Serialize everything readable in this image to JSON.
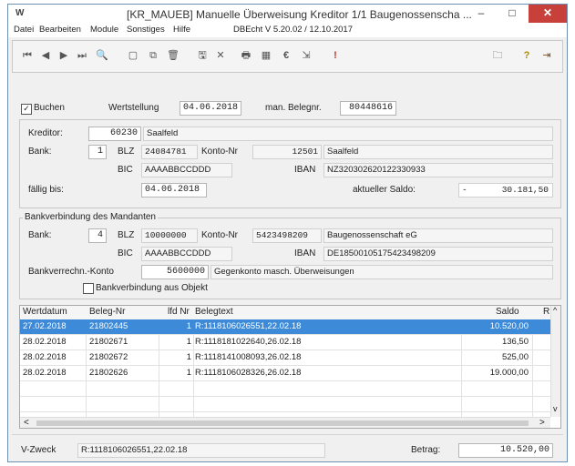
{
  "window": {
    "logo": "W",
    "title": "[KR_MAUEB] Manuelle Überweisung Kreditor  1/1 Baugenossenscha ...",
    "minimize": "–",
    "maximize": "□",
    "close": "✕"
  },
  "menu": [
    "Datei",
    "Bearbeiten",
    "Module",
    "Sonstiges",
    "Hilfe"
  ],
  "version": "DBEcht V 5.20.02 / 12.10.2017",
  "toolbar": {
    "first": "⏮",
    "prev": "◀",
    "next": "▶",
    "last": "⏭",
    "find": "🔍",
    "new": "▢",
    "copy": "⧉",
    "delete": "🗑",
    "save": "🖫",
    "cancel": "✕",
    "print": "🖶",
    "calc": "▦",
    "euro": "€",
    "export": "⇲",
    "alert": "!",
    "folder": "🗀",
    "help": "?",
    "exit": "⇥"
  },
  "form": {
    "buchen_label": "Buchen",
    "wertstellung_label": "Wertstellung",
    "wertstellung": "04.06.2018",
    "belegnr_label": "man. Belegnr.",
    "belegnr": "80448616"
  },
  "kreditor": {
    "label": "Kreditor:",
    "nr": "60230",
    "name": "Saalfeld",
    "bank_label": "Bank:",
    "bank": "1",
    "blz_label": "BLZ",
    "blz": "24084781",
    "konto_label": "Konto-Nr",
    "konto": "12501",
    "bankname": "Saalfeld",
    "bic_label": "BIC",
    "bic": "AAAABBCCDDD",
    "iban_label": "IBAN",
    "iban": "NZ320302620122330933",
    "faellig_label": "fällig bis:",
    "faellig": "04.06.2018",
    "saldo_label": "aktueller Saldo:",
    "saldo_sign": "-",
    "saldo": "30.181,50"
  },
  "mandant": {
    "legend": "Bankverbindung des Mandanten",
    "bank_label": "Bank:",
    "bank": "4",
    "blz_label": "BLZ",
    "blz": "10000000",
    "konto_label": "Konto-Nr",
    "konto": "5423498209",
    "bankname": "Baugenossenschaft eG",
    "bic_label": "BIC",
    "bic": "AAAABBCCDDD",
    "iban_label": "IBAN",
    "iban": "DE18500105175423498209",
    "verrechnung_label": "Bankverrechn.-Konto",
    "verrechnung": "5600000",
    "verrechnung_text": "Gegenkonto masch. Überweisungen",
    "objekt_label": "Bankverbindung aus Objekt"
  },
  "grid": {
    "headers": [
      "Wertdatum",
      "Beleg-Nr",
      "lfd Nr",
      "Belegtext",
      "Saldo",
      "R"
    ],
    "rows": [
      {
        "datum": "27.02.2018",
        "beleg": "21802445",
        "lfd": "1",
        "text": "R:1118106026551,22.02.18",
        "saldo": "10.520,00"
      },
      {
        "datum": "28.02.2018",
        "beleg": "21802671",
        "lfd": "1",
        "text": "R:1118181022640,26.02.18",
        "saldo": "136,50"
      },
      {
        "datum": "28.02.2018",
        "beleg": "21802672",
        "lfd": "1",
        "text": "R:1118141008093,26.02.18",
        "saldo": "525,00"
      },
      {
        "datum": "28.02.2018",
        "beleg": "21802626",
        "lfd": "1",
        "text": "R:1118106028326,26.02.18",
        "saldo": "19.000,00"
      }
    ],
    "scroll_left": "<",
    "scroll_right": ">",
    "scroll_up": "^",
    "scroll_down": "v"
  },
  "footer": {
    "vzweck_label": "V-Zweck",
    "vzweck": "R:1118106026551,22.02.18",
    "betrag_label": "Betrag:",
    "betrag": "10.520,00"
  },
  "colors": {
    "selected_row": "#3c8ad8",
    "close_button": "#c7403a"
  }
}
